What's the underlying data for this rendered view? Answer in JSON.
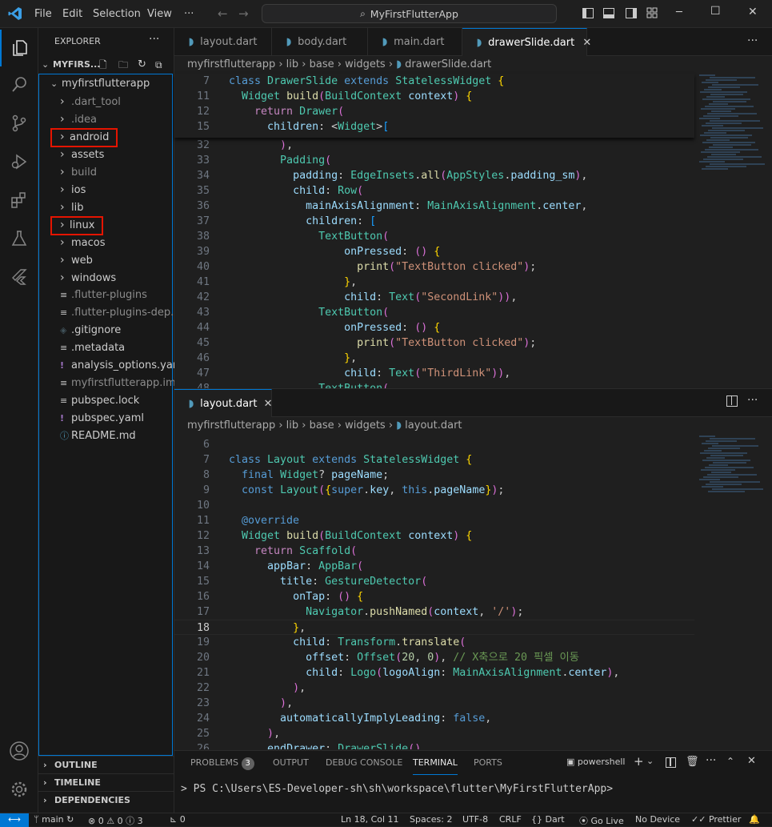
{
  "window": {
    "menu": [
      "File",
      "Edit",
      "Selection",
      "View",
      "···"
    ],
    "command_center": "MyFirstFlutterApp",
    "controls": [
      "─",
      "☐",
      "✕"
    ]
  },
  "explorer": {
    "header": "EXPLORER",
    "root": "MYFIRS...",
    "project": "myfirstflutterapp",
    "items": [
      {
        "label": ".dart_tool",
        "type": "folder",
        "dim": true
      },
      {
        "label": ".idea",
        "type": "folder",
        "dim": true
      },
      {
        "label": "android",
        "type": "folder",
        "highlight": true
      },
      {
        "label": "assets",
        "type": "folder"
      },
      {
        "label": "build",
        "type": "folder",
        "dim": true
      },
      {
        "label": "ios",
        "type": "folder"
      },
      {
        "label": "lib",
        "type": "folder"
      },
      {
        "label": "linux",
        "type": "folder",
        "highlight": true
      },
      {
        "label": "macos",
        "type": "folder"
      },
      {
        "label": "web",
        "type": "folder"
      },
      {
        "label": "windows",
        "type": "folder"
      },
      {
        "label": ".flutter-plugins",
        "type": "file",
        "icon": "lines",
        "dim": true
      },
      {
        "label": ".flutter-plugins-dep...",
        "type": "file",
        "icon": "lines",
        "dim": true
      },
      {
        "label": ".gitignore",
        "type": "file",
        "icon": "git"
      },
      {
        "label": ".metadata",
        "type": "file",
        "icon": "lines"
      },
      {
        "label": "analysis_options.yaml",
        "type": "file",
        "icon": "yaml"
      },
      {
        "label": "myfirstflutterapp.iml",
        "type": "file",
        "icon": "lines",
        "dim": true
      },
      {
        "label": "pubspec.lock",
        "type": "file",
        "icon": "lines"
      },
      {
        "label": "pubspec.yaml",
        "type": "file",
        "icon": "yaml"
      },
      {
        "label": "README.md",
        "type": "file",
        "icon": "info"
      }
    ],
    "sections": [
      "OUTLINE",
      "TIMELINE",
      "DEPENDENCIES"
    ]
  },
  "editor_top": {
    "tabs": [
      {
        "label": "layout.dart",
        "active": false
      },
      {
        "label": "body.dart",
        "active": false
      },
      {
        "label": "main.dart",
        "active": false
      },
      {
        "label": "drawerSlide.dart",
        "active": true
      }
    ],
    "breadcrumb": [
      "myfirstflutterapp",
      "lib",
      "base",
      "widgets",
      "drawerSlide.dart"
    ],
    "sticky": [
      {
        "n": "7",
        "code": "class DrawerSlide extends StatelessWidget {"
      },
      {
        "n": "11",
        "code": "  Widget build(BuildContext context) {"
      },
      {
        "n": "12",
        "code": "    return Drawer("
      },
      {
        "n": "15",
        "code": "      children: <Widget>["
      }
    ],
    "lines": [
      {
        "n": "32",
        "code": "        ),"
      },
      {
        "n": "33",
        "code": "        Padding("
      },
      {
        "n": "34",
        "code": "          padding: EdgeInsets.all(AppStyles.padding_sm),"
      },
      {
        "n": "35",
        "code": "          child: Row("
      },
      {
        "n": "36",
        "code": "            mainAxisAlignment: MainAxisAlignment.center,"
      },
      {
        "n": "37",
        "code": "            children: ["
      },
      {
        "n": "38",
        "code": "              TextButton("
      },
      {
        "n": "39",
        "code": "                  onPressed: () {"
      },
      {
        "n": "40",
        "code": "                    print(\"TextButton clicked\");"
      },
      {
        "n": "41",
        "code": "                  },"
      },
      {
        "n": "42",
        "code": "                  child: Text(\"SecondLink\")),"
      },
      {
        "n": "43",
        "code": "              TextButton("
      },
      {
        "n": "44",
        "code": "                  onPressed: () {"
      },
      {
        "n": "45",
        "code": "                    print(\"TextButton clicked\");"
      },
      {
        "n": "46",
        "code": "                  },"
      },
      {
        "n": "47",
        "code": "                  child: Text(\"ThirdLink\")),"
      },
      {
        "n": "48",
        "code": "              TextButton("
      }
    ]
  },
  "editor_bottom": {
    "tab": "layout.dart",
    "breadcrumb": [
      "myfirstflutterapp",
      "lib",
      "base",
      "widgets",
      "layout.dart"
    ],
    "lines": [
      {
        "n": "6",
        "code": ""
      },
      {
        "n": "7",
        "code": "class Layout extends StatelessWidget {"
      },
      {
        "n": "8",
        "code": "  final Widget? pageName;"
      },
      {
        "n": "9",
        "code": "  const Layout({super.key, this.pageName});"
      },
      {
        "n": "10",
        "code": ""
      },
      {
        "n": "11",
        "code": "  @override"
      },
      {
        "n": "12",
        "code": "  Widget build(BuildContext context) {"
      },
      {
        "n": "13",
        "code": "    return Scaffold("
      },
      {
        "n": "14",
        "code": "      appBar: AppBar("
      },
      {
        "n": "15",
        "code": "        title: GestureDetector("
      },
      {
        "n": "16",
        "code": "          onTap: () {"
      },
      {
        "n": "17",
        "code": "            Navigator.pushNamed(context, '/');"
      },
      {
        "n": "18",
        "code": "          },"
      },
      {
        "n": "19",
        "code": "          child: Transform.translate("
      },
      {
        "n": "20",
        "code": "            offset: Offset(20, 0), // X축으로 20 픽셀 이동"
      },
      {
        "n": "21",
        "code": "            child: Logo(logoAlign: MainAxisAlignment.center),"
      },
      {
        "n": "22",
        "code": "          ),"
      },
      {
        "n": "23",
        "code": "        ),"
      },
      {
        "n": "24",
        "code": "        automaticallyImplyLeading: false,"
      },
      {
        "n": "25",
        "code": "      ),"
      },
      {
        "n": "26",
        "code": "      endDrawer: DrawerSlide(),"
      }
    ]
  },
  "panel": {
    "tabs": [
      "PROBLEMS",
      "OUTPUT",
      "DEBUG CONSOLE",
      "TERMINAL",
      "PORTS"
    ],
    "problems_count": "3",
    "shell": "powershell",
    "terminal_line": "PS C:\\Users\\ES-Developer-sh\\sh\\workspace\\flutter\\MyFirstFlutterApp>"
  },
  "statusbar": {
    "branch": "main",
    "errors": "0",
    "warnings": "0",
    "info": "3",
    "ports": "0",
    "position": "Ln 18, Col 11",
    "spaces": "Spaces: 2",
    "encoding": "UTF-8",
    "eol": "CRLF",
    "language": "Dart",
    "golive": "Go Live",
    "device": "No Device",
    "prettier": "Prettier"
  },
  "colors": {
    "accent": "#0078d4",
    "highlight": "#e51400",
    "bg": "#1f1f1f"
  }
}
